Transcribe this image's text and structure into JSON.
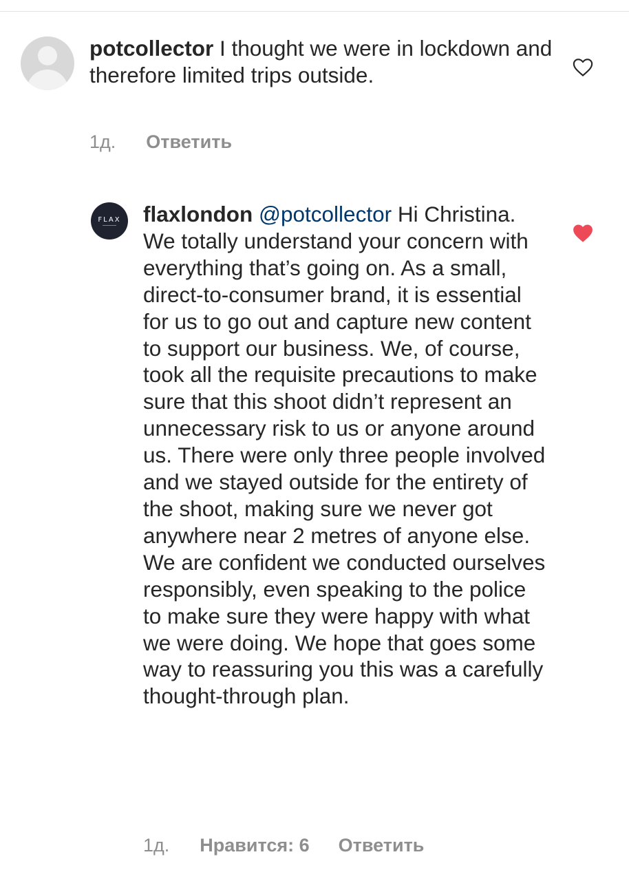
{
  "comments": [
    {
      "username": "potcollector",
      "mention": "",
      "text": " I thought we were in lockdown and therefore limited trips outside.",
      "time": "1д.",
      "likes_label": "",
      "reply_label": "Ответить",
      "liked": false,
      "avatar_icon": "default-user-avatar-icon",
      "heart_icon": "heart-outline-icon"
    },
    {
      "username": "flaxlondon",
      "mention": "@potcollector",
      "text": " Hi Christina. We totally understand your concern with everything that’s going on. As a small, direct-to-consumer brand, it is essential for us to go out and capture new content to support our business. We, of course, took all the requisite precautions to make sure that this shoot didn’t represent an unnecessary risk to us or anyone around us. There were only three people involved and we stayed outside for the entirety of the shoot, making sure we never got anywhere near 2 metres of anyone else. We are confident we conducted ourselves responsibly, even speaking to the police to make sure they were happy with what we were doing. We hope that goes some way to reassuring you this was a carefully thought-through plan.",
      "time": "1д.",
      "likes_label": "Нравится: 6",
      "reply_label": "Ответить",
      "liked": true,
      "avatar_logo_text": "FLAX",
      "avatar_icon": "flax-logo-avatar-icon",
      "heart_icon": "heart-filled-icon"
    }
  ],
  "colors": {
    "text": "#262626",
    "meta": "#8e8e8e",
    "mention": "#00376b",
    "liked_heart": "#ed4956",
    "flax_avatar_bg": "#1f2330"
  }
}
